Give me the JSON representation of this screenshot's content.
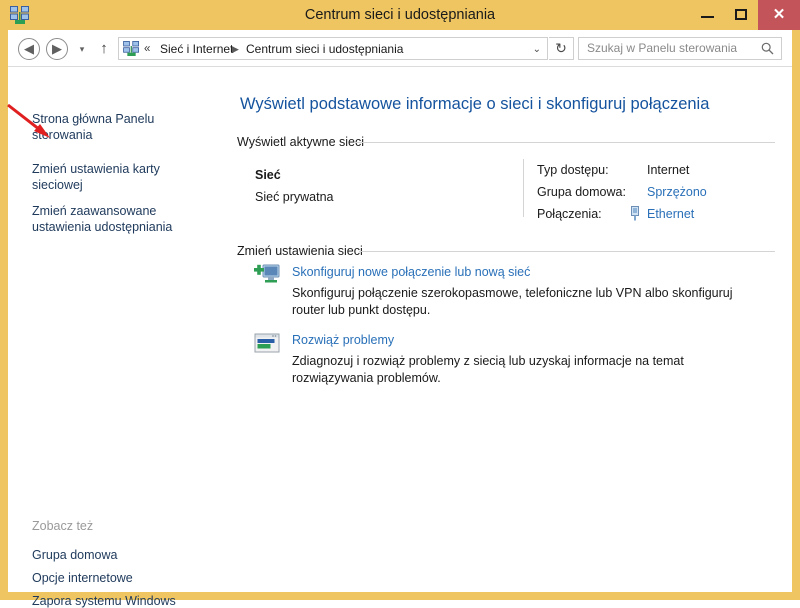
{
  "window": {
    "title": "Centrum sieci i udostępniania",
    "icon": "network-icon",
    "controls": {
      "minimize": "—",
      "maximize": "☐",
      "close": "✕"
    },
    "colors": {
      "titlebar": "#eec561",
      "close_button": "#c3545a",
      "heading_blue": "#15539e",
      "link_blue": "#2970b8",
      "nav_link_navy": "#1e395b"
    }
  },
  "navbar": {
    "back_icon": "◀",
    "forward_icon": "▶",
    "recent_icon": "▾",
    "up_icon": "↑",
    "address": {
      "icon": "network-icon",
      "chevrons": "«",
      "crumb1": "Sieć i Internet",
      "separator": "▶",
      "crumb2": "Centrum sieci i udostępniania",
      "dropdown_icon": "⌄"
    },
    "refresh_icon": "↻",
    "search": {
      "placeholder": "Szukaj w Panelu sterowania",
      "icon": "search-icon"
    }
  },
  "sidebar": {
    "links": [
      {
        "label": "Strona główna Panelu sterowania"
      },
      {
        "label": "Zmień ustawienia karty sieciowej"
      },
      {
        "label": "Zmień zaawansowane ustawienia udostępniania"
      }
    ],
    "see_also": {
      "label": "Zobacz też",
      "items": [
        {
          "label": "Grupa domowa"
        },
        {
          "label": "Opcje internetowe"
        },
        {
          "label": "Zapora systemu Windows"
        }
      ]
    }
  },
  "main": {
    "heading": "Wyświetl podstawowe informacje o sieci i skonfiguruj połączenia",
    "sections": [
      {
        "title": "Wyświetl aktywne sieci"
      },
      {
        "title": "Zmień ustawienia sieci"
      }
    ],
    "active_network": {
      "name": "Sieć",
      "type": "Sieć prywatna",
      "details": [
        {
          "label": "Typ dostępu:",
          "value": "Internet",
          "is_link": false
        },
        {
          "label": "Grupa domowa:",
          "value": "Sprzężono",
          "is_link": true
        },
        {
          "label": "Połączenia:",
          "value": "Ethernet",
          "is_link": true,
          "icon": "ethernet-icon"
        }
      ]
    },
    "tasks": [
      {
        "icon": "new-connection-icon",
        "link": "Skonfiguruj nowe połączenie lub nową sieć",
        "description": "Skonfiguruj połączenie szerokopasmowe, telefoniczne lub VPN albo skonfiguruj router lub punkt dostępu."
      },
      {
        "icon": "troubleshoot-icon",
        "link": "Rozwiąż problemy",
        "description": "Zdiagnozuj i rozwiąż problemy z siecią lub uzyskaj informacje na temat rozwiązywania problemów."
      }
    ]
  },
  "annotation": {
    "arrow": "red-arrow",
    "color": "#e02020"
  }
}
